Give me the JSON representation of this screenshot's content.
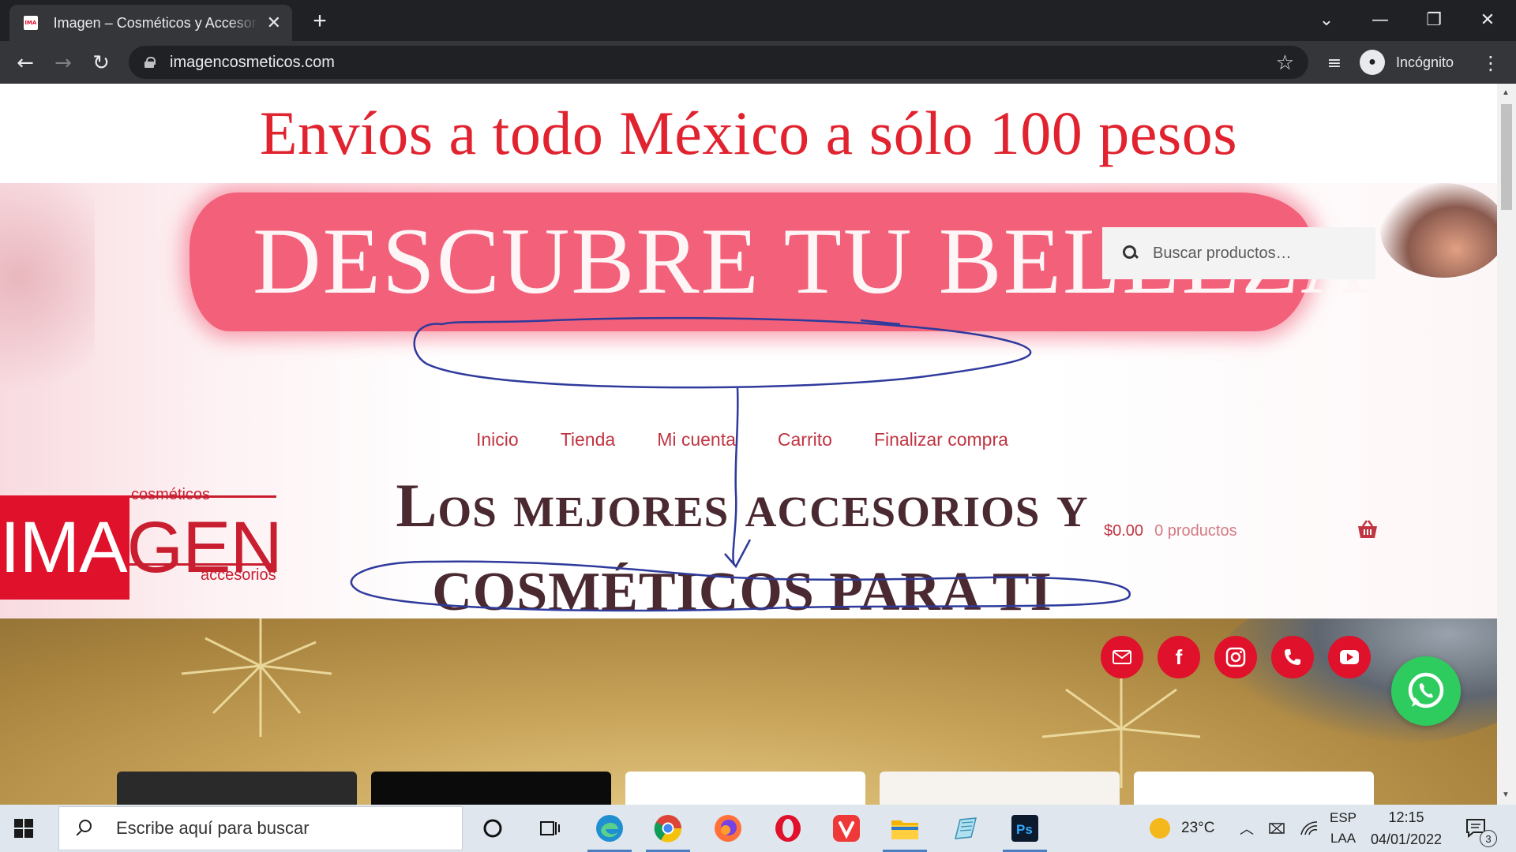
{
  "browser": {
    "tab_title": "Imagen – Cosméticos y Accesorios",
    "favicon_text": "IMA",
    "url": "imagencosmeticos.com",
    "profile_label": "Incógnito",
    "new_tab_glyph": "+",
    "tab_close_glyph": "✕"
  },
  "page": {
    "banner": "Envíos a todo México a sólo 100 pesos",
    "hero_title": "DESCUBRE TU BELLEZA",
    "search_placeholder": "Buscar productos…",
    "menu": [
      "Inicio",
      "Tienda",
      "Mi cuenta",
      "Carrito",
      "Finalizar compra"
    ],
    "logo": {
      "top": "cosméticos",
      "main_left": "IMA",
      "main_right": "GEN",
      "bottom": "accesorios"
    },
    "tagline_line1": "Los mejores accesorios y",
    "tagline_line2": "COSMÉTICOS PARA TI",
    "cart_amount": "$0.00",
    "cart_count": "0 productos",
    "social": [
      "email-icon",
      "facebook-icon",
      "instagram-icon",
      "phone-icon",
      "youtube-icon"
    ]
  },
  "taskbar": {
    "search_text": "Escribe aquí para buscar",
    "temperature": "23°C",
    "language_top": "ESP",
    "language_bottom": "LAA",
    "time": "12:15",
    "date": "04/01/2022",
    "notifications": "3"
  },
  "colors": {
    "brand_red": "#e0112b",
    "menu_red": "#c03542",
    "hero_pink": "#f2607a",
    "annotation_blue": "#2e3a9c",
    "whatsapp_green": "#2ecc5f"
  }
}
